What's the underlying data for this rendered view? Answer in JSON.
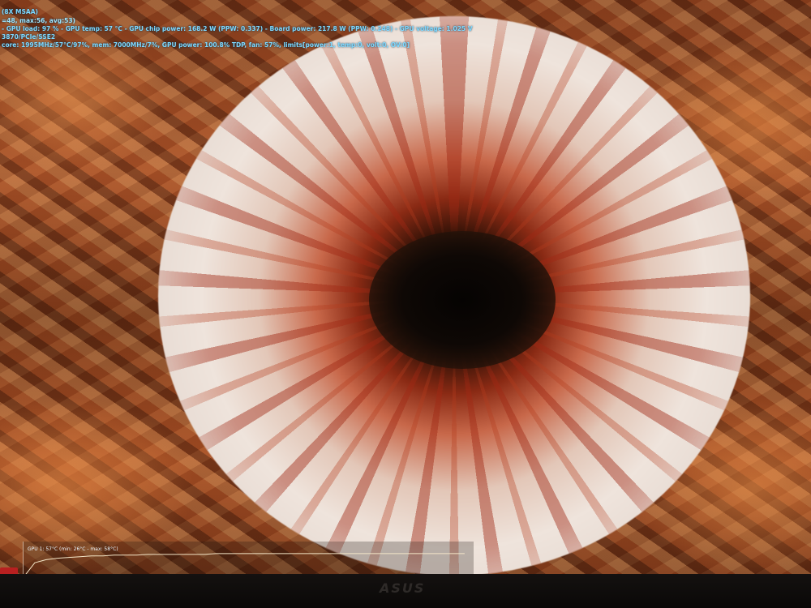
{
  "osd": {
    "line_1": "(8X MSAA)",
    "line_2": "=48, max:56, avg:53)",
    "line_3": "- GPU load: 97 % - GPU temp: 57 °C - GPU chip power: 168.2 W (PPW: 0.337) - Board power: 217.8 W (PPW: 0.248) - GPU voltage: 1.025 V",
    "line_4": "3870/PCIe/SSE2",
    "line_5": "core: 1995MHz/57°C/97%, mem: 7000MHz/7%, GPU power: 100.8% TDP, fan: 57%, limits[power:1, temp:0, volt:0, OV:0]"
  },
  "graph": {
    "label": "GPU 1: 57°C (min: 26°C - max: 58°C)",
    "line_color": "#f4e6c8",
    "y_range": [
      26,
      58
    ],
    "samples": [
      26,
      45,
      49,
      51,
      52,
      53,
      54,
      54,
      55,
      55,
      55,
      56,
      56,
      56,
      56,
      56,
      56,
      57,
      57,
      57,
      57,
      57,
      57,
      57,
      57,
      57,
      57,
      57,
      57,
      57,
      57,
      57,
      57,
      57,
      57,
      57,
      57,
      57,
      57,
      57
    ]
  },
  "monitor": {
    "brand": "ASUS"
  }
}
